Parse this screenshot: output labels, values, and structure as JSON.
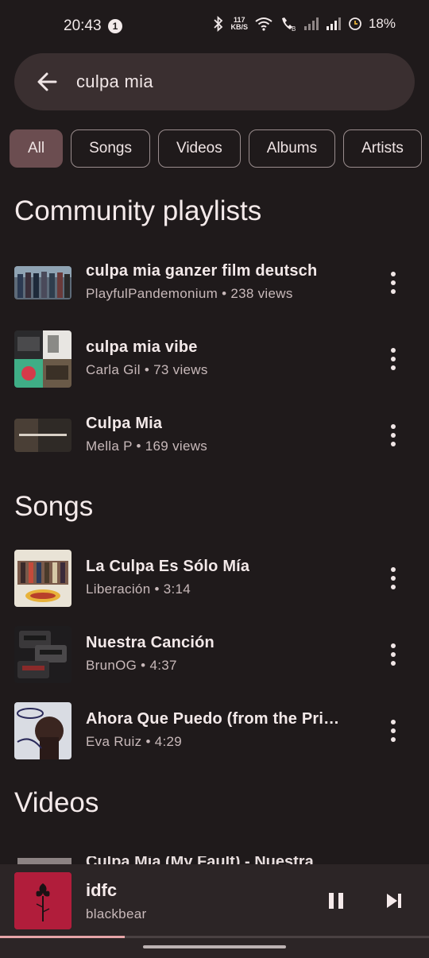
{
  "status_bar": {
    "time": "20:43",
    "notification_count": "1",
    "net_speed_value": "117",
    "net_speed_unit": "KB/S",
    "battery": "18%"
  },
  "search": {
    "query": "culpa mia"
  },
  "filters": [
    "All",
    "Songs",
    "Videos",
    "Albums",
    "Artists"
  ],
  "active_filter": "All",
  "community_playlists": {
    "title": "Community playlists",
    "items": [
      {
        "title": "culpa mia ganzer film deutsch",
        "subtitle": "PlayfulPandemonium • 238 views"
      },
      {
        "title": "culpa mia vibe",
        "subtitle": "Carla Gil • 73 views"
      },
      {
        "title": "Culpa Mia",
        "subtitle": "Mella P • 169 views"
      }
    ]
  },
  "songs": {
    "title": "Songs",
    "items": [
      {
        "title": "La Culpa Es Sólo Mía",
        "subtitle": "Liberación • 3:14"
      },
      {
        "title": "Nuestra Canción",
        "subtitle": "BrunOG • 4:37"
      },
      {
        "title": "Ahora Que Puedo (from the Pri…",
        "subtitle": "Eva Ruiz • 4:29"
      }
    ]
  },
  "videos": {
    "title": "Videos",
    "partial_item_title": "Culpa Mia (My Fault) - Nuestra"
  },
  "now_playing": {
    "title": "idfc",
    "artist": "blackbear",
    "progress": 0.29
  },
  "colors": {
    "background": "#1f1a1b",
    "search_bar": "#3a2f30",
    "active_chip": "#6b4d50",
    "mini_player": "#2c2526",
    "progress": "#e7a5a8",
    "album_idfc": "#b11d3b"
  },
  "icons": [
    "back-arrow-icon",
    "more-vert-icon",
    "pause-icon",
    "skip-next-icon",
    "bluetooth-icon",
    "wifi-icon",
    "signal-icon",
    "battery-icon"
  ]
}
